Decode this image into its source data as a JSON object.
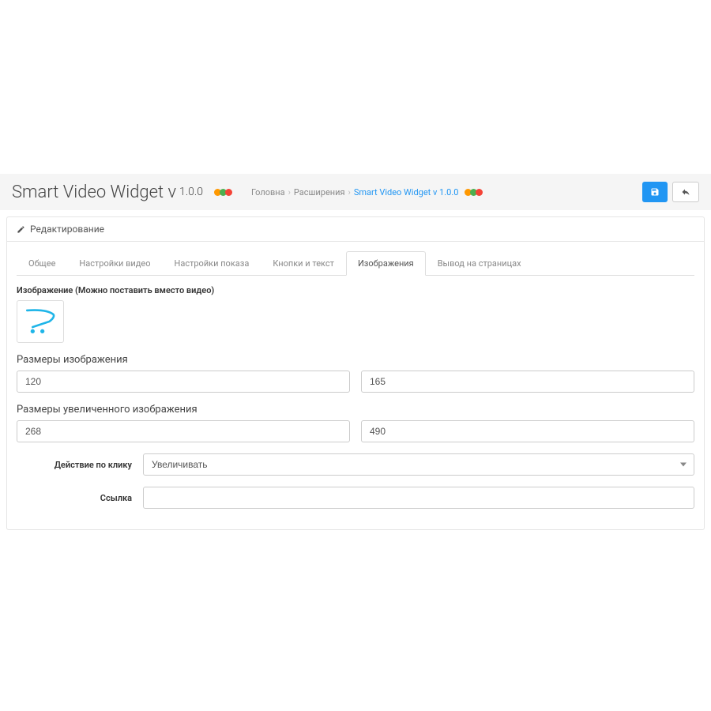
{
  "header": {
    "title": "Smart Video Widget v",
    "version": "1.0.0"
  },
  "breadcrumbs": {
    "home": "Головна",
    "extensions": "Расширения",
    "current": "Smart Video Widget v 1.0.0"
  },
  "panel": {
    "heading": "Редактирование"
  },
  "tabs": [
    {
      "label": "Общее"
    },
    {
      "label": "Настройки видео"
    },
    {
      "label": "Настройки показа"
    },
    {
      "label": "Кнопки и текст"
    },
    {
      "label": "Изображения"
    },
    {
      "label": "Вывод на страницах"
    }
  ],
  "form": {
    "image_label": "Изображение (Можно поставить вместо видео)",
    "image_size_label": "Размеры изображения",
    "image_width": "120",
    "image_height": "165",
    "enlarged_size_label": "Размеры увеличенного изображения",
    "enlarged_width": "268",
    "enlarged_height": "490",
    "click_action_label": "Действие по клику",
    "click_action_value": "Увеличивать",
    "link_label": "Ссылка",
    "link_value": ""
  }
}
